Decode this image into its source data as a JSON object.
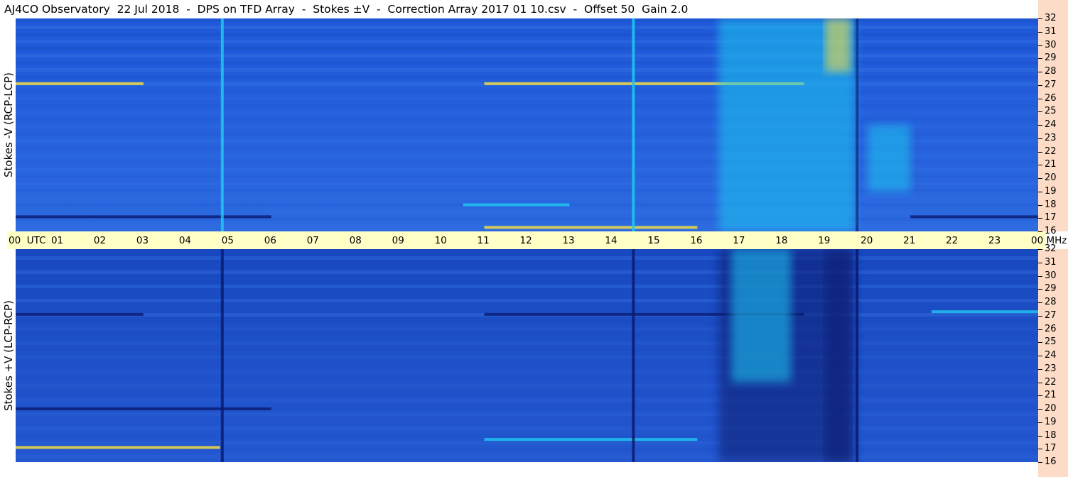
{
  "title": "AJ4CO Observatory  22 Jul 2018  -  DPS on TFD Array  -  Stokes ±V  -  Correction Array 2017 01 10.csv  -  Offset 50  Gain 2.0",
  "chart_data": [
    {
      "type": "heatmap",
      "ylabel": "Stokes -V (RCP-LCP)",
      "x_unit": "UTC",
      "xlim": [
        "00",
        "00"
      ],
      "y_unit": "MHz",
      "ylim": [
        16,
        32
      ],
      "y_ticks": [
        "16",
        "17",
        "18",
        "19",
        "20",
        "21",
        "22",
        "23",
        "24",
        "25",
        "26",
        "27",
        "28",
        "29",
        "30",
        "31",
        "32"
      ],
      "colors": {
        "background": "#2a62d6",
        "enhanced": "#1ec8f0",
        "strong": "#ffe23a",
        "depleted": "#0a1a70"
      },
      "features": [
        {
          "kind": "horizontal-band",
          "freq_mhz": 27.1,
          "start_utc": 0.0,
          "end_utc": 3.0,
          "level": "strong"
        },
        {
          "kind": "horizontal-band",
          "freq_mhz": 27.1,
          "start_utc": 11.0,
          "end_utc": 18.5,
          "level": "strong"
        },
        {
          "kind": "horizontal-band",
          "freq_mhz": 17.1,
          "start_utc": 0.0,
          "end_utc": 6.0,
          "level": "depleted"
        },
        {
          "kind": "horizontal-band",
          "freq_mhz": 17.1,
          "start_utc": 21.0,
          "end_utc": 24.0,
          "level": "depleted"
        },
        {
          "kind": "horizontal-band",
          "freq_mhz": 18.0,
          "start_utc": 10.5,
          "end_utc": 13.0,
          "level": "enhanced"
        },
        {
          "kind": "horizontal-band",
          "freq_mhz": 16.3,
          "start_utc": 11.0,
          "end_utc": 16.0,
          "level": "strong"
        },
        {
          "kind": "vertical-line",
          "time_utc": 4.85,
          "level": "enhanced"
        },
        {
          "kind": "vertical-line",
          "time_utc": 14.5,
          "level": "enhanced"
        },
        {
          "kind": "vertical-line",
          "time_utc": 19.75,
          "level": "depleted"
        },
        {
          "kind": "emission-region",
          "start_utc": 16.5,
          "end_utc": 19.7,
          "freq_low": 16,
          "freq_high": 32,
          "level": "enhanced"
        },
        {
          "kind": "emission-region",
          "start_utc": 19.0,
          "end_utc": 19.6,
          "freq_low": 28,
          "freq_high": 32,
          "level": "strong"
        },
        {
          "kind": "emission-region",
          "start_utc": 20.0,
          "end_utc": 21.0,
          "freq_low": 19,
          "freq_high": 24,
          "level": "enhanced"
        }
      ]
    },
    {
      "type": "heatmap",
      "ylabel": "Stokes +V (LCP-RCP)",
      "x_unit": "UTC",
      "xlim": [
        "00",
        "00"
      ],
      "y_unit": "MHz",
      "ylim": [
        16,
        32
      ],
      "y_ticks": [
        "16",
        "17",
        "18",
        "19",
        "20",
        "21",
        "22",
        "23",
        "24",
        "25",
        "26",
        "27",
        "28",
        "29",
        "30",
        "31",
        "32"
      ],
      "colors": {
        "background": "#2a62d6",
        "enhanced": "#1ec8f0",
        "strong": "#ffe23a",
        "depleted": "#0a1a70"
      },
      "features": [
        {
          "kind": "horizontal-band",
          "freq_mhz": 27.1,
          "start_utc": 0.0,
          "end_utc": 3.0,
          "level": "depleted"
        },
        {
          "kind": "horizontal-band",
          "freq_mhz": 27.1,
          "start_utc": 11.0,
          "end_utc": 18.5,
          "level": "depleted"
        },
        {
          "kind": "horizontal-band",
          "freq_mhz": 17.1,
          "start_utc": 0.0,
          "end_utc": 4.8,
          "level": "strong"
        },
        {
          "kind": "horizontal-band",
          "freq_mhz": 20.0,
          "start_utc": 0.0,
          "end_utc": 6.0,
          "level": "depleted"
        },
        {
          "kind": "horizontal-band",
          "freq_mhz": 17.7,
          "start_utc": 11.0,
          "end_utc": 16.0,
          "level": "enhanced"
        },
        {
          "kind": "horizontal-band",
          "freq_mhz": 27.3,
          "start_utc": 21.5,
          "end_utc": 24.0,
          "level": "enhanced"
        },
        {
          "kind": "vertical-line",
          "time_utc": 4.85,
          "level": "depleted"
        },
        {
          "kind": "vertical-line",
          "time_utc": 14.5,
          "level": "depleted"
        },
        {
          "kind": "vertical-line",
          "time_utc": 19.75,
          "level": "depleted"
        },
        {
          "kind": "emission-region",
          "start_utc": 16.5,
          "end_utc": 19.7,
          "freq_low": 16,
          "freq_high": 32,
          "level": "depleted"
        },
        {
          "kind": "emission-region",
          "start_utc": 16.8,
          "end_utc": 18.2,
          "freq_low": 22,
          "freq_high": 32,
          "level": "enhanced"
        },
        {
          "kind": "emission-region",
          "start_utc": 19.0,
          "end_utc": 19.6,
          "freq_low": 16,
          "freq_high": 32,
          "level": "depleted"
        }
      ]
    }
  ],
  "time_axis": {
    "ticks": [
      "00",
      "01",
      "02",
      "03",
      "04",
      "05",
      "06",
      "07",
      "08",
      "09",
      "10",
      "11",
      "12",
      "13",
      "14",
      "15",
      "16",
      "17",
      "18",
      "19",
      "20",
      "21",
      "22",
      "23",
      "00"
    ],
    "start_suffix": "UTC",
    "end_suffix": "MHz"
  }
}
